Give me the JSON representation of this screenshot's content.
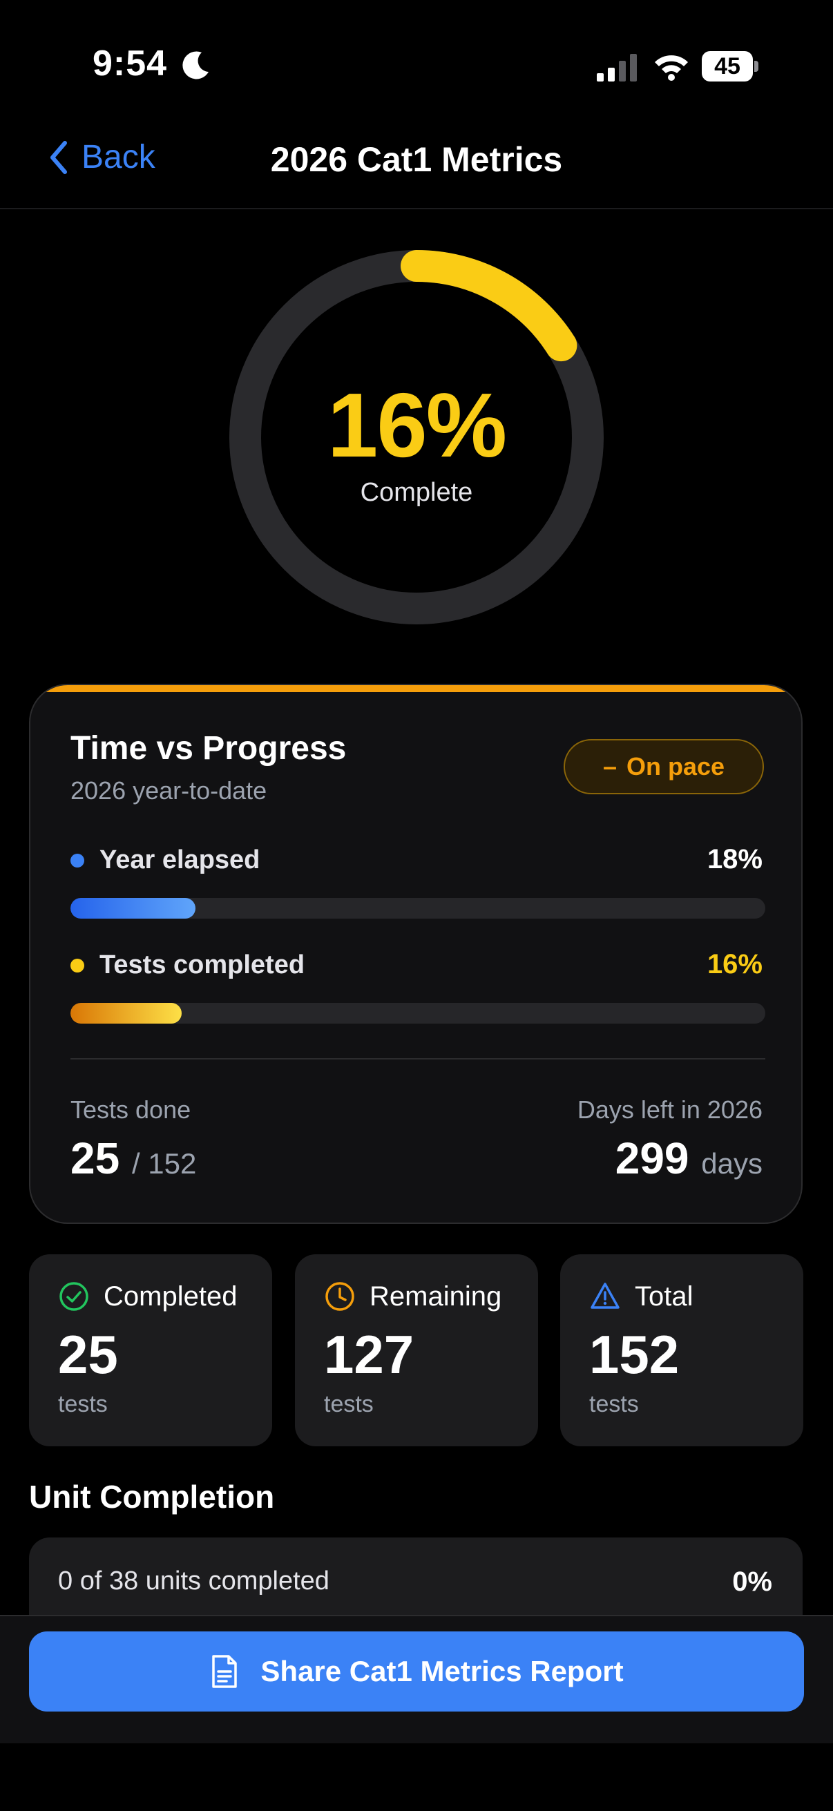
{
  "status_bar": {
    "time": "9:54",
    "battery": "45"
  },
  "nav": {
    "back_label": "Back",
    "title": "2026 Cat1 Metrics"
  },
  "progress_ring": {
    "percent_text": "16%",
    "percent_value": 16,
    "label": "Complete",
    "track_color": "#2a2a2d",
    "fill_color": "#facc15"
  },
  "time_vs_progress": {
    "title": "Time vs Progress",
    "subtitle": "2026 year-to-date",
    "status_badge": "On pace",
    "status_symbol": "–",
    "year_elapsed": {
      "label": "Year elapsed",
      "value_text": "18%",
      "value": 18,
      "color": "#3b82f6"
    },
    "tests_completed": {
      "label": "Tests completed",
      "value_text": "16%",
      "value": 16,
      "color": "#facc15"
    },
    "tests_done": {
      "label": "Tests done",
      "value": "25",
      "total": "/ 152"
    },
    "days_left": {
      "label": "Days left in 2026",
      "value": "299",
      "unit": "days"
    }
  },
  "summary_cards": [
    {
      "label": "Completed",
      "value": "25",
      "unit": "tests",
      "icon": "check-circle-icon",
      "icon_color": "#22c55e"
    },
    {
      "label": "Remaining",
      "value": "127",
      "unit": "tests",
      "icon": "clock-icon",
      "icon_color": "#f59e0b"
    },
    {
      "label": "Total",
      "value": "152",
      "unit": "tests",
      "icon": "warning-triangle-icon",
      "icon_color": "#3b82f6"
    }
  ],
  "unit_completion": {
    "title": "Unit Completion",
    "summary": "0 of 38 units completed",
    "percent": "0%"
  },
  "share_button": {
    "label": "Share Cat1 Metrics Report",
    "icon": "document-icon"
  },
  "colors": {
    "accent_blue": "#3b82f6",
    "accent_yellow": "#facc15",
    "accent_orange": "#f59e0b",
    "success_green": "#22c55e"
  }
}
